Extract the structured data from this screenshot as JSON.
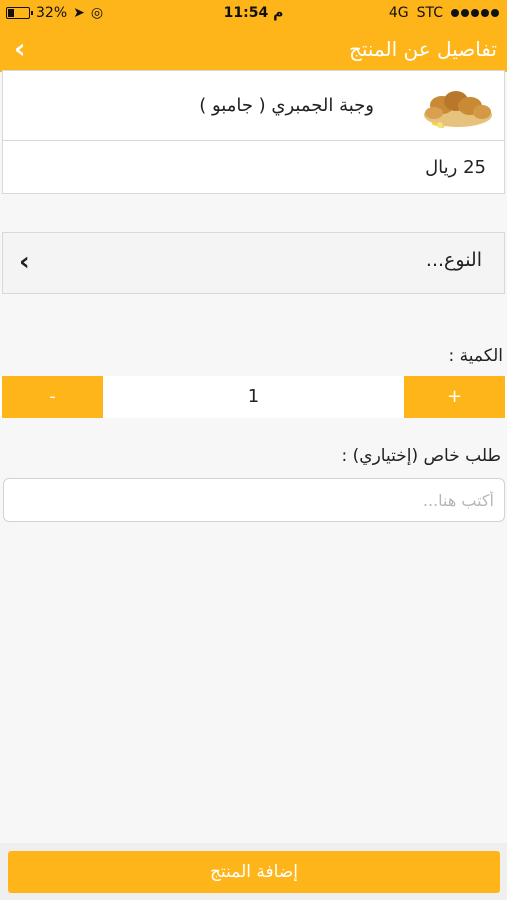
{
  "status_bar": {
    "battery": "32%",
    "battery_level": 0.32,
    "time": "11:54 م",
    "network": "4G",
    "carrier": "STC"
  },
  "header": {
    "title": "تفاصيل عن المنتج",
    "back_icon": "chevron-left-icon"
  },
  "product": {
    "name": "وجبة الجمبري ( جامبو )",
    "price": "25 ريال",
    "image_icon": "shrimp-meal-image"
  },
  "type_select": {
    "label": "النوع...",
    "chevron_icon": "chevron-left-icon"
  },
  "quantity": {
    "label": "الكمية :",
    "value": "1",
    "minus_label": "-",
    "plus_label": "+"
  },
  "special_request": {
    "label": "طلب خاص (إختياري) :",
    "placeholder": "أكتب هنا..."
  },
  "footer": {
    "add_button_label": "إضافة المنتج"
  },
  "colors": {
    "accent": "#fdb51a",
    "background": "#f7f7f7"
  }
}
